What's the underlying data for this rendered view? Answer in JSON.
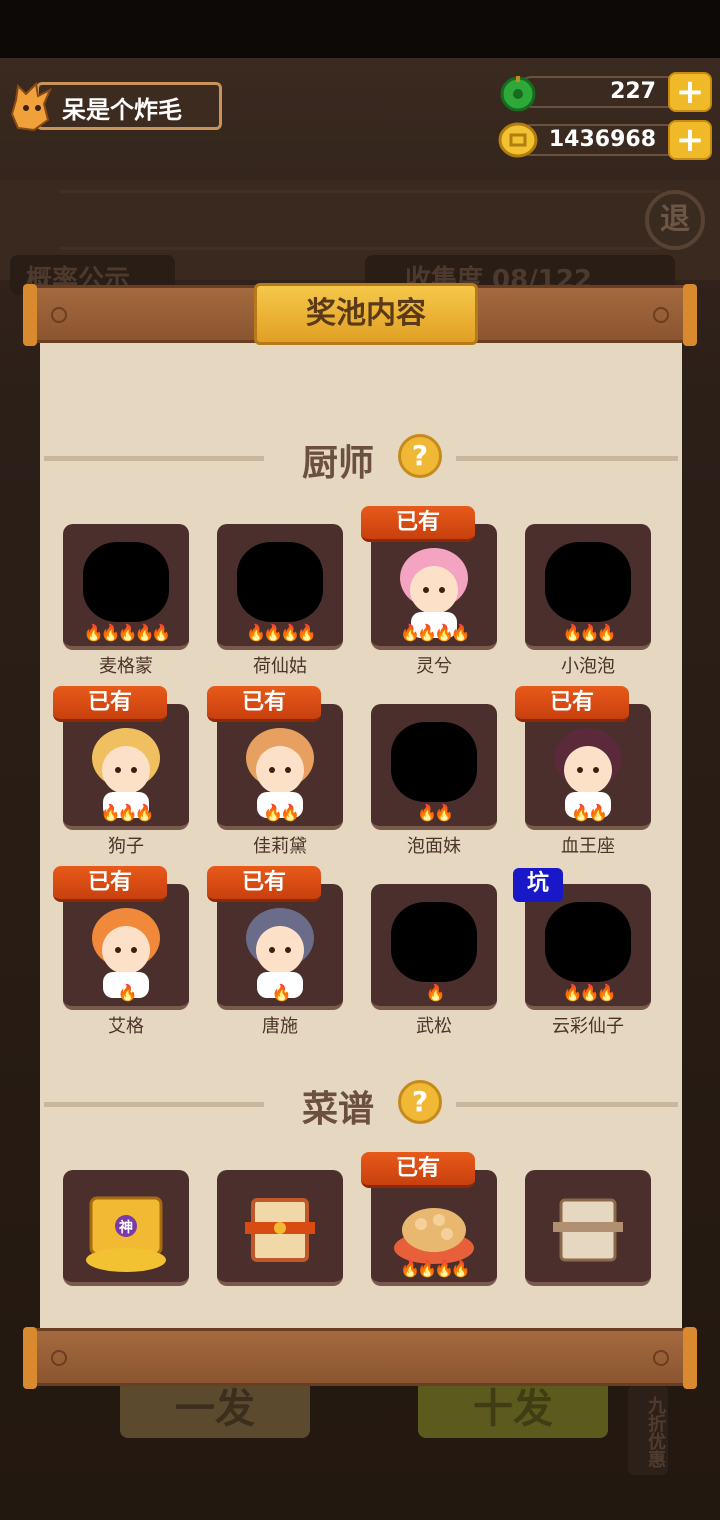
{
  "player": {
    "name": "呆是个炸毛"
  },
  "resources": {
    "jade": "227",
    "coins": "1436968"
  },
  "background": {
    "notice_tab": "概率公示",
    "collection_tab": "收集度 08/122",
    "exit_label": "退",
    "single_draw": "一发",
    "ten_draw": "十发",
    "discount": "九折优惠"
  },
  "dialog": {
    "title": "奖池内容",
    "chef_section": "厨师",
    "recipe_section": "菜谱",
    "owned_badge": "已有",
    "pit_badge": "坑",
    "chefs": [
      {
        "name": "麦格蒙",
        "stars": 5,
        "owned": false
      },
      {
        "name": "荷仙姑",
        "stars": 4,
        "owned": false
      },
      {
        "name": "灵兮",
        "stars": 4,
        "owned": true
      },
      {
        "name": "小泡泡",
        "stars": 3,
        "owned": false
      },
      {
        "name": "狗子",
        "stars": 3,
        "owned": true
      },
      {
        "name": "佳莉黛",
        "stars": 2,
        "owned": true
      },
      {
        "name": "泡面妹",
        "stars": 2,
        "owned": false
      },
      {
        "name": "血王座",
        "stars": 2,
        "owned": true
      },
      {
        "name": "艾格",
        "stars": 1,
        "owned": true
      },
      {
        "name": "唐施",
        "stars": 1,
        "owned": true
      },
      {
        "name": "武松",
        "stars": 1,
        "owned": false
      },
      {
        "name": "云彩仙子",
        "stars": 3,
        "owned": false,
        "pit": true
      }
    ],
    "recipes": [
      {
        "icon": "god-recipe-scroll-icon",
        "badge": "神",
        "owned": false
      },
      {
        "icon": "red-recipe-scroll-icon",
        "owned": false
      },
      {
        "icon": "dumpling-bowl-icon",
        "owned": true,
        "stars": 4
      },
      {
        "icon": "plain-recipe-scroll-icon",
        "owned": false
      }
    ]
  },
  "colors": {
    "owned_badge": "#d84c14",
    "pit_badge": "#1818c8",
    "card_bg": "#4a2f2c",
    "parchment": "#e6d7c1"
  }
}
